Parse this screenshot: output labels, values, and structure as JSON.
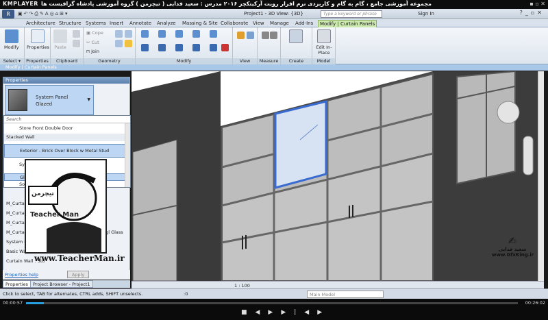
{
  "player": {
    "brand": "KMPLAYER",
    "title": "مجموعه آموزشی جامع ، گام به گام و کاربردی نرم افزار رویت آرکیتکچر ۲۰۱۶   مدرس : سعید فدایی ( تیچرمن ) گروه آموزشی پادشاه گرافیست ها",
    "time_elapsed": "00:00:57",
    "time_total": "00:26:02",
    "progress": 0.036
  },
  "app": {
    "document_title": "Project1 - 3D View: {3D}",
    "search_placeholder": "Type a keyword or phrase",
    "sign_in": "Sign In"
  },
  "ribbon_tabs": [
    "Architecture",
    "Structure",
    "Systems",
    "Insert",
    "Annotate",
    "Analyze",
    "Massing & Site",
    "Collaborate",
    "View",
    "Manage",
    "Add-Ins",
    "Modify | Curtain Panels"
  ],
  "ribbon": {
    "modify": "Modify",
    "properties": "Properties",
    "clipboard": {
      "paste": "Paste",
      "cope": "Cope",
      "cut": "Cut",
      "join": "Join"
    },
    "panels": [
      "Select",
      "Properties",
      "Clipboard",
      "Geometry",
      "Modify",
      "View",
      "Measure",
      "Create",
      "Model"
    ],
    "edit_inplace": "Edit In-Place",
    "select_label": "Select ▾"
  },
  "context_bar": "Modify | Curtain Panels",
  "properties": {
    "header": "Properties",
    "type_name": "System Panel",
    "type_sub": "Glazed",
    "rows": [
      "M_Curtain W",
      "M_Curtain W",
      "M_Curtain W",
      "M_Curtain Wall: Sgl Glass 1 M_Curtain Wall Sgl Glass",
      "System Panel : Solid",
      "Basic Wall : Gene",
      "Curtain Wall : Sto"
    ],
    "help": "Properties help",
    "apply": "Apply"
  },
  "dropdown": {
    "search": "Search",
    "items": [
      {
        "kind": "item",
        "label": "Store Front Double Door"
      },
      {
        "kind": "group",
        "label": "Stacked Wall"
      },
      {
        "kind": "sel",
        "label": "Exterior - Brick Over Block w Metal Stud"
      },
      {
        "kind": "group",
        "label": "System Panel"
      },
      {
        "kind": "sel",
        "label": "Glazed"
      },
      {
        "kind": "item",
        "label": "Solid"
      }
    ]
  },
  "bottom_tabs": [
    "Properties",
    "Project Browser - Project1"
  ],
  "view": {
    "scale": "1 : 100"
  },
  "status": {
    "hint": "Click to select, TAB for alternates, CTRL adds, SHIFT unselects.",
    "zero": ":0",
    "model": "Main Model"
  },
  "watermark": {
    "logo_title": "تیچرمن",
    "logo_name": "Teacher Man",
    "site": "www.TeacherMan.ir",
    "author": "سعید فدایی",
    "site2": "www.GfxKing.ir"
  },
  "colors": {
    "ribbon_ctx": "#cdeab0",
    "accent": "#28a0e0",
    "select": "#bcd6f3"
  }
}
